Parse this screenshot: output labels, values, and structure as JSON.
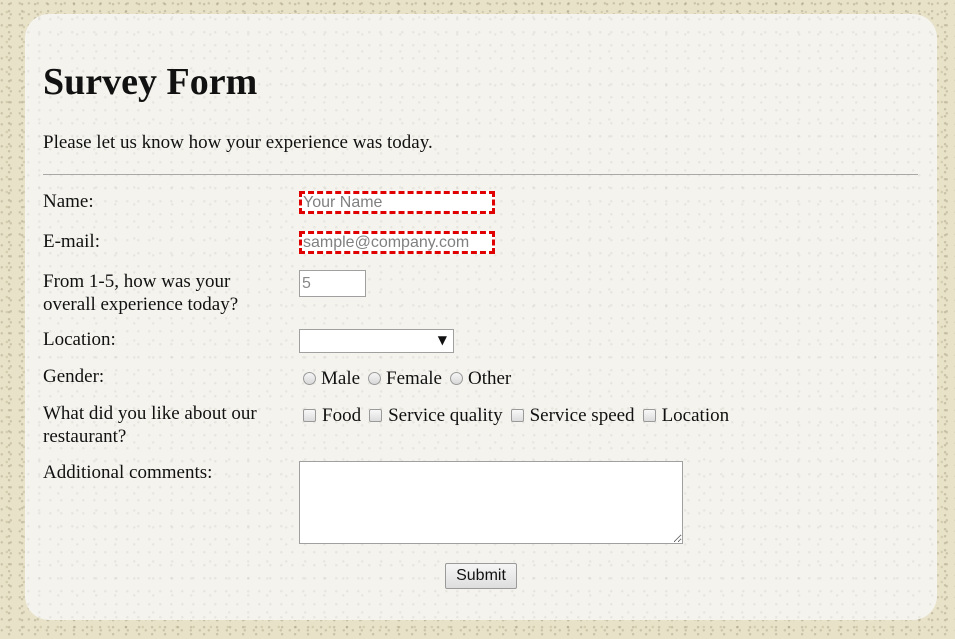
{
  "form": {
    "title": "Survey Form",
    "intro": "Please let us know how your experience was today.",
    "name": {
      "label": "Name:",
      "placeholder": "Your Name",
      "value": ""
    },
    "email": {
      "label": "E-mail:",
      "placeholder": "sample@company.com",
      "value": ""
    },
    "rating": {
      "label": "From 1-5, how was your overall experience today?",
      "placeholder": "5",
      "value": ""
    },
    "location": {
      "label": "Location:",
      "selected": ""
    },
    "gender": {
      "label": "Gender:",
      "options": [
        "Male",
        "Female",
        "Other"
      ]
    },
    "likes": {
      "label": "What did you like about our restaurant?",
      "options": [
        "Food",
        "Service quality",
        "Service speed",
        "Location"
      ]
    },
    "comments": {
      "label": "Additional comments:",
      "value": ""
    },
    "submit_label": "Submit"
  },
  "icons": {
    "select_arrow": "triangle-down-icon"
  },
  "colors": {
    "invalid_border": "#e00000",
    "page_background": "#e8e2c8",
    "card_background": "#f4f3ee"
  }
}
